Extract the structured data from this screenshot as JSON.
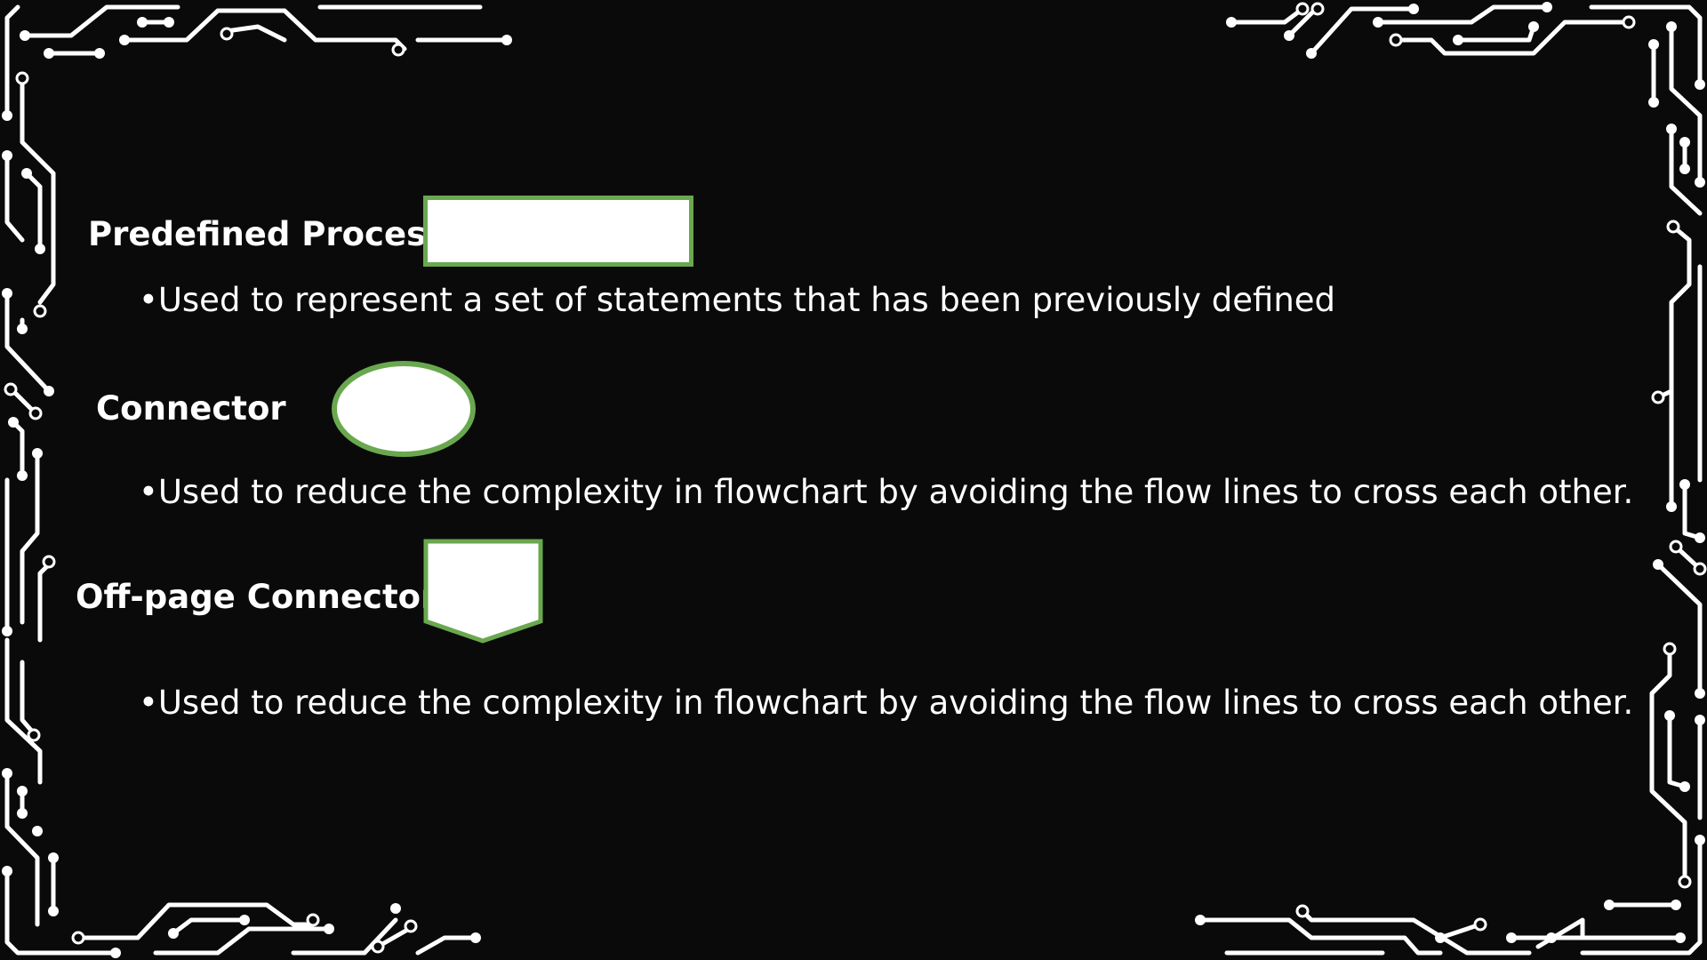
{
  "slide": {
    "accent_color": "#6aa84f",
    "shape_fill": "#ffffff",
    "text_color": "#ffffff",
    "background_color": "#0a0a0a",
    "sections": [
      {
        "heading": "Predefined Process",
        "symbol": "rectangle-symbol",
        "description": "•Used to represent a set of statements that has been previously defined"
      },
      {
        "heading": "Connector",
        "symbol": "ellipse-symbol",
        "description": "•Used to reduce the complexity in flowchart by avoiding the flow lines to cross each other."
      },
      {
        "heading": "Off-page Connector",
        "symbol": "pentagon-symbol",
        "description": "•Used to reduce the complexity in flowchart by avoiding the flow lines to cross each other."
      }
    ]
  }
}
